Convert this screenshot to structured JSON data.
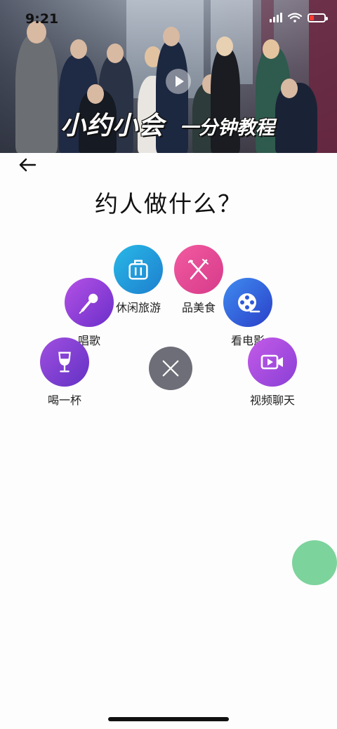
{
  "status_bar": {
    "time": "9:21",
    "battery_color": "#ff3b30"
  },
  "banner": {
    "title": "小约小会",
    "subtitle": "一分钟教程",
    "play_icon": "play-icon"
  },
  "header": {
    "back_icon": "arrow-left-icon",
    "title": "约人做什么？"
  },
  "menu": {
    "items": [
      {
        "label": "休闲旅游",
        "icon": "suitcase-icon",
        "color_start": "#28b8e6",
        "color_end": "#1e7fcf"
      },
      {
        "label": "品美食",
        "icon": "fork-knife-icon",
        "color_start": "#f25aa0",
        "color_end": "#d63b8a"
      },
      {
        "label": "唱歌",
        "icon": "microphone-icon",
        "color_start": "#b451e6",
        "color_end": "#6a2fc9"
      },
      {
        "label": "看电影",
        "icon": "film-reel-icon",
        "color_start": "#3f8cf0",
        "color_end": "#2a3fc9"
      },
      {
        "label": "喝一杯",
        "icon": "wine-glass-icon",
        "color_start": "#a04fe0",
        "color_end": "#6332c4"
      },
      {
        "label": "视频聊天",
        "icon": "video-camera-icon",
        "color_start": "#c45be8",
        "color_end": "#8a3fd6"
      }
    ],
    "close_icon": "close-icon",
    "close_color": "#6e6e78"
  },
  "fab": {
    "color": "#7dd39c"
  }
}
